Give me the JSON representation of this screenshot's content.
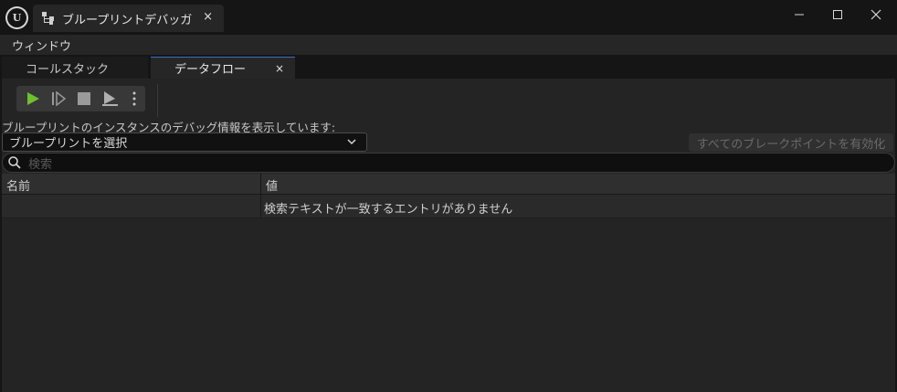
{
  "titlebar": {
    "tab_title": "ブループリントデバッガ",
    "tab_close": "×",
    "minimize": "—",
    "maximize": "☐",
    "close": "✕"
  },
  "menubar": {
    "items": [
      {
        "label": "ウィンドウ"
      }
    ]
  },
  "panel_tabs": [
    {
      "label": "コールスタック",
      "active": false
    },
    {
      "label": "データフロー",
      "active": true,
      "close": "×"
    }
  ],
  "toolbar": {
    "buttons": [
      "play-icon",
      "step-icon",
      "stop-icon",
      "eject-icon",
      "more-icon"
    ],
    "play_color": "#6fbf2f"
  },
  "content": {
    "info_label": "ブループリントのインスタンスのデバッグ情報を表示しています:",
    "select_value": "ブループリントを選択",
    "enable_button": "すべてのブレークポイントを有効化",
    "search_placeholder": "検索"
  },
  "table": {
    "columns": [
      "名前",
      "値"
    ],
    "empty_message": "検索テキストが一致するエントリがありません"
  },
  "colors": {
    "accent": "#3b6fc0",
    "background": "#242424"
  }
}
